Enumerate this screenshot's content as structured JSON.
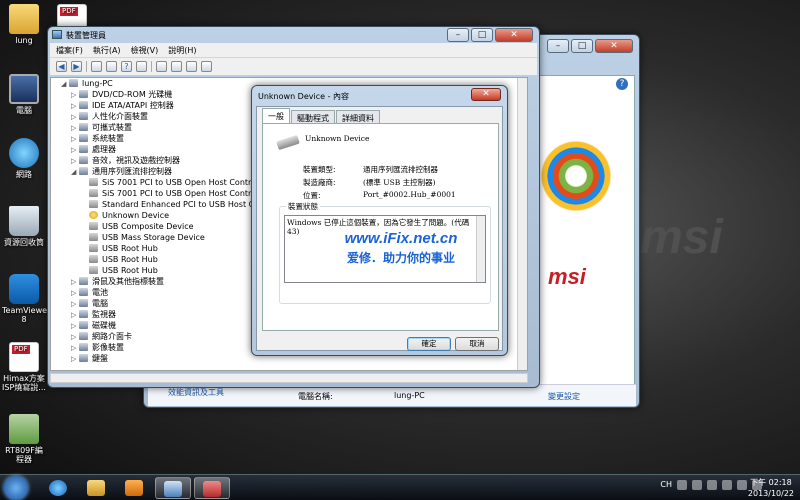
{
  "desktop": {
    "icons": [
      {
        "label": "lung",
        "icon": "folder-icon"
      },
      {
        "label": "電腦",
        "icon": "computer-icon"
      },
      {
        "label": "網路",
        "icon": "network-icon"
      },
      {
        "label": "資源回收筒",
        "icon": "recycle-bin-icon"
      },
      {
        "label": "TeamViewer 8",
        "icon": "teamviewer-icon"
      },
      {
        "label": "Himax方案 ISP燒寫說...",
        "icon": "pdf-icon"
      },
      {
        "label": "RT809F編程器",
        "icon": "package-icon"
      }
    ],
    "background_brand": "msi"
  },
  "device_manager": {
    "title": "裝置管理員",
    "menu": [
      "檔案(F)",
      "執行(A)",
      "檢視(V)",
      "說明(H)"
    ],
    "tree": [
      {
        "level": 0,
        "expand": "◢",
        "label": "lung-PC",
        "icon": "computer"
      },
      {
        "level": 1,
        "expand": "▷",
        "label": "DVD/CD-ROM 光碟機"
      },
      {
        "level": 1,
        "expand": "▷",
        "label": "IDE ATA/ATAPI 控制器"
      },
      {
        "level": 1,
        "expand": "▷",
        "label": "人性化介面裝置"
      },
      {
        "level": 1,
        "expand": "▷",
        "label": "可攜式裝置"
      },
      {
        "level": 1,
        "expand": "▷",
        "label": "系統裝置"
      },
      {
        "level": 1,
        "expand": "▷",
        "label": "處理器"
      },
      {
        "level": 1,
        "expand": "▷",
        "label": "音效，視訊及遊戲控制器"
      },
      {
        "level": 1,
        "expand": "◢",
        "label": "通用序列匯流排控制器"
      },
      {
        "level": 2,
        "expand": "",
        "label": "SiS 7001 PCI to USB Open Host Controller",
        "icon": "usb"
      },
      {
        "level": 2,
        "expand": "",
        "label": "SiS 7001 PCI to USB Open Host Controller",
        "icon": "usb"
      },
      {
        "level": 2,
        "expand": "",
        "label": "Standard Enhanced PCI to USB Host Controller",
        "icon": "usb"
      },
      {
        "level": 2,
        "expand": "",
        "label": "Unknown Device",
        "icon": "unknown"
      },
      {
        "level": 2,
        "expand": "",
        "label": "USB Composite Device",
        "icon": "usb"
      },
      {
        "level": 2,
        "expand": "",
        "label": "USB Mass Storage Device",
        "icon": "usb"
      },
      {
        "level": 2,
        "expand": "",
        "label": "USB Root Hub",
        "icon": "usb"
      },
      {
        "level": 2,
        "expand": "",
        "label": "USB Root Hub",
        "icon": "usb"
      },
      {
        "level": 2,
        "expand": "",
        "label": "USB Root Hub",
        "icon": "usb"
      },
      {
        "level": 1,
        "expand": "▷",
        "label": "滑鼠及其他指標裝置"
      },
      {
        "level": 1,
        "expand": "▷",
        "label": "電池"
      },
      {
        "level": 1,
        "expand": "▷",
        "label": "電腦"
      },
      {
        "level": 1,
        "expand": "▷",
        "label": "監視器"
      },
      {
        "level": 1,
        "expand": "▷",
        "label": "磁碟機"
      },
      {
        "level": 1,
        "expand": "▷",
        "label": "網路介面卡"
      },
      {
        "level": 1,
        "expand": "▷",
        "label": "影像裝置"
      },
      {
        "level": 1,
        "expand": "▷",
        "label": "鍵盤"
      }
    ]
  },
  "background_window": {
    "bottom_left": "效能資訊及工具",
    "computer_name_label": "電腦名稱:",
    "computer_name_value": "lung-PC",
    "change_settings": "變更設定"
  },
  "properties_dialog": {
    "title": "Unknown Device - 內容",
    "tabs": [
      "一般",
      "驅動程式",
      "詳細資料"
    ],
    "device_name": "Unknown Device",
    "rows": [
      {
        "label": "裝置類型:",
        "value": "通用序列匯流排控制器"
      },
      {
        "label": "製造廠商:",
        "value": "(標準 USB 主控制器)"
      },
      {
        "label": "位置:",
        "value": "Port_#0002.Hub_#0001"
      }
    ],
    "status_group_label": "裝置狀態",
    "status_text": "Windows 已停止這個裝置，因為它發生了問題。(代碼 43)",
    "ok_label": "確定",
    "cancel_label": "取消"
  },
  "watermark": {
    "line1": "www.iFix.net.cn",
    "line2": "爱修．助力你的事业"
  },
  "taskbar": {
    "tray_lang": "CH",
    "time": "下午 02:18",
    "date": "2013/10/22"
  }
}
